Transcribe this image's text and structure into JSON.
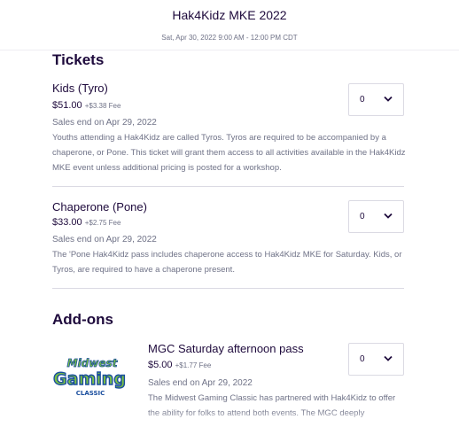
{
  "header": {
    "title": "Hak4Kidz MKE 2022",
    "date": "Sat, Apr 30, 2022 9:00 AM - 12:00 PM CDT"
  },
  "tickets": {
    "section_title": "Tickets",
    "items": [
      {
        "name": "Kids (Tyro)",
        "price": "$51.00",
        "fee": "+$3.38 Fee",
        "sales_end": "Sales end on Apr 29, 2022",
        "description": "Youths attending a Hak4Kidz are called Tyros. Tyros are required to be accompanied by a chaperone, or Pone. This ticket will grant them access to all activities available in the Hak4Kidz MKE event unless additional pricing is posted for a workshop.",
        "quantity": "0"
      },
      {
        "name": "Chaperone (Pone)",
        "price": "$33.00",
        "fee": "+$2.75 Fee",
        "sales_end": "Sales end on Apr 29, 2022",
        "description": "The 'Pone Hak4Kidz pass includes chaperone access to Hak4Kidz MKE for Saturday. Kids, or Tyros, are required to have a chaperone present.",
        "quantity": "0"
      }
    ]
  },
  "addons": {
    "section_title": "Add-ons",
    "items": [
      {
        "name": "MGC Saturday afternoon pass",
        "price": "$5.00",
        "fee": "+$1.77 Fee",
        "sales_end": "Sales end on Apr 29, 2022",
        "description": "The Midwest Gaming Classic has partnered with Hak4Kidz to offer the ability for folks to attend both events. The MGC deeply",
        "quantity": "0",
        "logo_text": [
          "Midwest",
          "Gaming",
          "CLASSIC"
        ]
      }
    ]
  },
  "icons": {
    "dropdown": "chevron-down-icon"
  },
  "colors": {
    "heading": "#1e0a3c",
    "muted": "#6f7287",
    "border": "#dbdae3",
    "logo_green": "#7ac143",
    "logo_blue": "#1a4e9e"
  }
}
